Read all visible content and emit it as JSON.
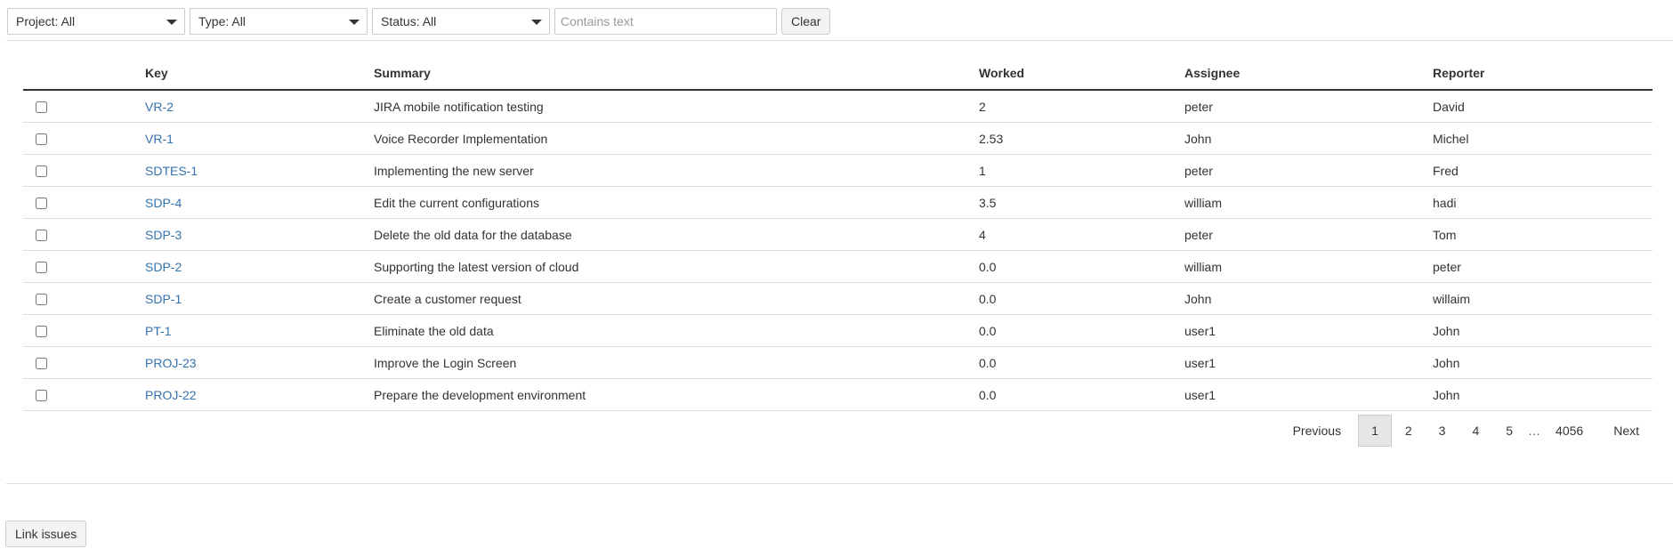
{
  "filters": {
    "project_label": "Project: All",
    "type_label": "Type: All",
    "status_label": "Status: All",
    "text_placeholder": "Contains text",
    "text_value": "",
    "clear_label": "Clear"
  },
  "table": {
    "columns": [
      "",
      "Key",
      "Summary",
      "Worked",
      "Assignee",
      "Reporter"
    ],
    "rows": [
      {
        "checked": false,
        "key": "VR-2",
        "summary": "JIRA mobile notification testing",
        "worked": "2",
        "assignee": "peter",
        "reporter": "David"
      },
      {
        "checked": false,
        "key": "VR-1",
        "summary": "Voice Recorder Implementation",
        "worked": "2.53",
        "assignee": "John",
        "reporter": "Michel"
      },
      {
        "checked": false,
        "key": "SDTES-1",
        "summary": "Implementing the new server",
        "worked": "1",
        "assignee": "peter",
        "reporter": "Fred"
      },
      {
        "checked": false,
        "key": "SDP-4",
        "summary": "Edit the current configurations",
        "worked": "3.5",
        "assignee": "william",
        "reporter": "hadi"
      },
      {
        "checked": false,
        "key": "SDP-3",
        "summary": "Delete the old data for the database",
        "worked": "4",
        "assignee": "peter",
        "reporter": "Tom"
      },
      {
        "checked": false,
        "key": "SDP-2",
        "summary": "Supporting the latest version of cloud",
        "worked": "0.0",
        "assignee": "william",
        "reporter": "peter"
      },
      {
        "checked": false,
        "key": "SDP-1",
        "summary": "Create a customer request",
        "worked": "0.0",
        "assignee": "John",
        "reporter": "willaim"
      },
      {
        "checked": false,
        "key": "PT-1",
        "summary": "Eliminate the old data",
        "worked": "0.0",
        "assignee": "user1",
        "reporter": "John"
      },
      {
        "checked": false,
        "key": "PROJ-23",
        "summary": "Improve the Login Screen",
        "worked": "0.0",
        "assignee": "user1",
        "reporter": "John"
      },
      {
        "checked": false,
        "key": "PROJ-22",
        "summary": "Prepare the development environment",
        "worked": "0.0",
        "assignee": "user1",
        "reporter": "John"
      }
    ]
  },
  "pagination": {
    "previous_label": "Previous",
    "pages": [
      "1",
      "2",
      "3",
      "4",
      "5"
    ],
    "active_page": "1",
    "ellipsis": "…",
    "last_page": "4056",
    "next_label": "Next"
  },
  "actions": {
    "link_issues_label": "Link issues"
  },
  "colors": {
    "link": "#3572b0",
    "border": "#dddddd",
    "header_rule": "#333333",
    "active_page_bg": "#e6e6e6"
  },
  "icons": {
    "dropdown": "chevron-down-icon"
  }
}
